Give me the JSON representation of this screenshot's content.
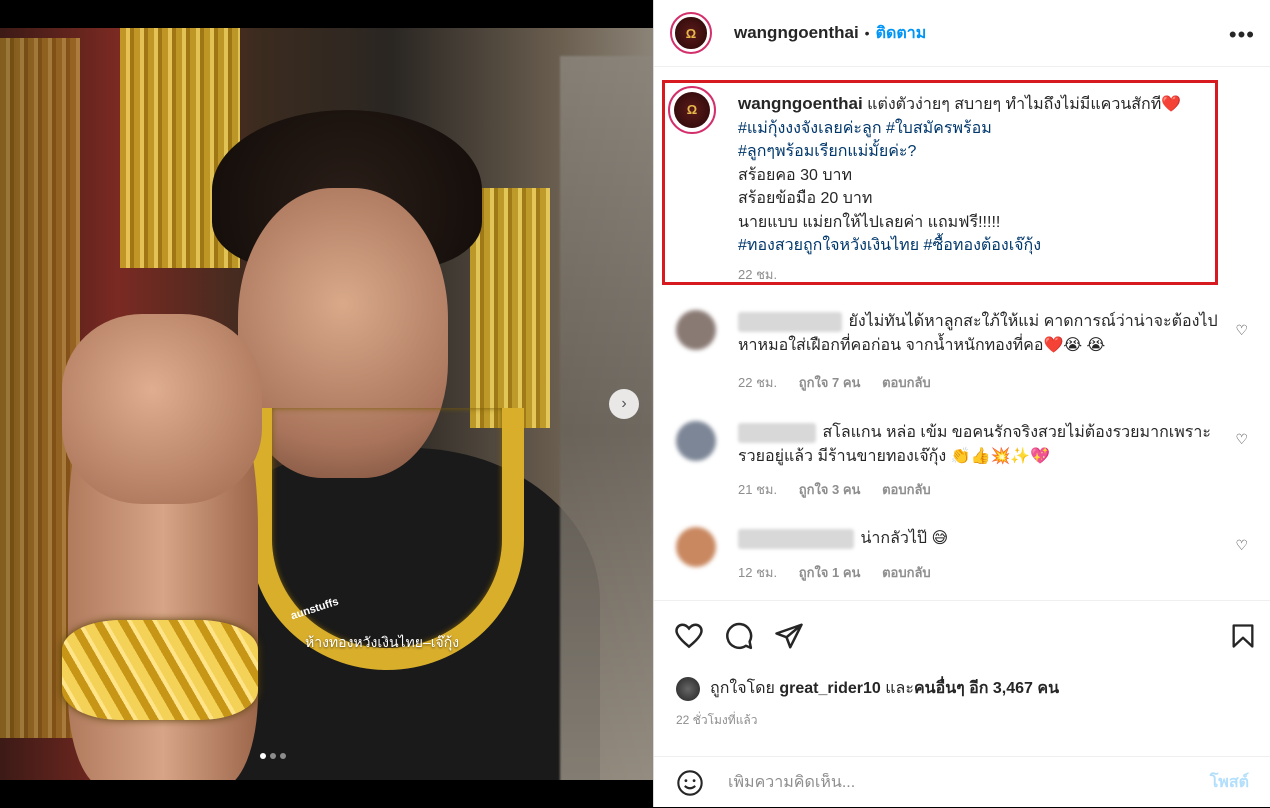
{
  "photo": {
    "overlay_text": "ห้างทองหวังเงินไทย–เจ๊กุ้ง",
    "shirt_text": "aunstuffs",
    "next_icon": "chevron-right-icon",
    "carousel": {
      "count": 3,
      "active": 1
    }
  },
  "header": {
    "avatar_text": "Ω",
    "username": "wangngoenthai",
    "separator": "•",
    "follow_label": "ติดตาม",
    "more_label": "•••"
  },
  "caption": {
    "username": "wangngoenthai",
    "line1": "แต่งตัวง่ายๆ สบายๆ ทำไมถึงไม่มีแควนสักที",
    "heart": "❤️",
    "tags1a": "#แม่กุ้งงงจังเลยค่ะลูก",
    "tags1b": "#ใบสมัครพร้อม",
    "tags2": "#ลูกๆพร้อมเรียกแม่มั้ยค่ะ?",
    "line3": "สร้อยคอ 30 บาท",
    "line4": "สร้อยข้อมือ 20 บาท",
    "line5": "นายแบบ แม่ยกให้ไปเลยค่า แถมฟรี!!!!!",
    "tags3a": "#ทองสวยถูกใจหวังเงินไทย",
    "tags3b": "#ซื้อทองต้องเจ๊กุ้ง",
    "time": "22 ชม."
  },
  "comments": [
    {
      "text": "ยังไม่ทันได้หาลูกสะใภ้ให้แม่ คาดการณ์ว่าน่าจะต้องไปหาหมอใส่เฝือกที่คอก่อน จากน้ำหนักทองที่คอ❤️😭 😭",
      "time": "22 ชม.",
      "likes": "ถูกใจ 7 คน",
      "reply": "ตอบกลับ"
    },
    {
      "text": "สโลแกน หล่อ เข้ม ขอคนรักจริงสวยไม่ต้องรวยมากเพราะรวยอยู่แล้ว มีร้านขายทองเจ๊กุ้ง 👏👍💥✨💖",
      "time": "21 ชม.",
      "likes": "ถูกใจ 3 คน",
      "reply": "ตอบกลับ"
    },
    {
      "text": "น่ากลัวไป๊ 😅",
      "time": "12 ชม.",
      "likes": "ถูกใจ 1 คน",
      "reply": "ตอบกลับ"
    }
  ],
  "actions": {
    "like_icon": "heart-icon",
    "comment_icon": "comment-icon",
    "share_icon": "paper-plane-icon",
    "save_icon": "bookmark-icon"
  },
  "likes": {
    "prefix": "ถูกใจโดย",
    "user": "great_rider10",
    "mid": "และ",
    "others": "คนอื่นๆ อีก 3,467 คน"
  },
  "post_time": "22 ชั่วโมงที่แล้ว",
  "composer": {
    "placeholder": "เพิ่มความคิดเห็น...",
    "post_label": "โพสต์",
    "emoji_icon": "smiley-icon"
  },
  "colors": {
    "accent": "#0095f6",
    "highlight_box": "#d71920",
    "tag": "#00376b"
  }
}
